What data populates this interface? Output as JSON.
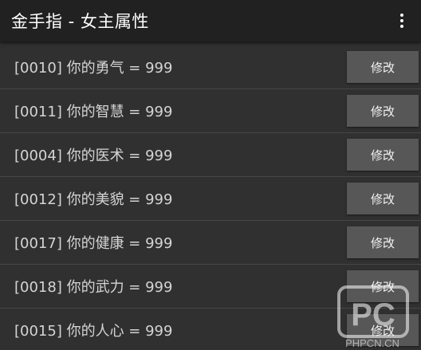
{
  "app": {
    "title": "金手指 - 女主属性",
    "menu_icon": "more-vert-icon"
  },
  "rows": [
    {
      "label": "[0010] 你的勇气 = 999",
      "button": "修改"
    },
    {
      "label": "[0011] 你的智慧 = 999",
      "button": "修改"
    },
    {
      "label": "[0004] 你的医术 = 999",
      "button": "修改"
    },
    {
      "label": "[0012] 你的美貌 = 999",
      "button": "修改"
    },
    {
      "label": "[0017] 你的健康 = 999",
      "button": "修改"
    },
    {
      "label": "[0018] 你的武力 = 999",
      "button": "修改"
    },
    {
      "label": "[0015] 你的人心 = 999",
      "button": "修改"
    }
  ],
  "watermark": {
    "logo_text": "PC",
    "caption": "PHPCN.CN"
  },
  "colors": {
    "background": "#303030",
    "toolbar": "#212121",
    "button": "#575757",
    "text": "#d4d4d4"
  }
}
